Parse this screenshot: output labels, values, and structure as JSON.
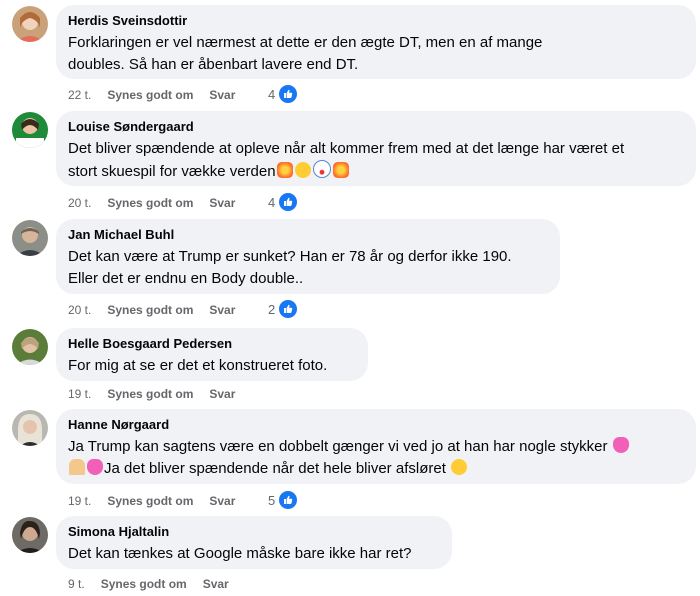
{
  "comments": [
    {
      "author": "Herdis Sveinsdottir",
      "text_lines": [
        "Forklaringen er vel nærmest at dette er den ægte DT, men en af mange",
        "doubles. Så han er åbenbart lavere end DT."
      ],
      "time": "22 t.",
      "like_label": "Synes godt om",
      "reply_label": "Svar",
      "reactions": "4"
    },
    {
      "author": "Louise Søndergaard",
      "text_lines": [
        "Det bliver spændende at opleve når alt kommer frem med at det længe har været et",
        "stort skuespil for vække verden"
      ],
      "time": "20 t.",
      "like_label": "Synes godt om",
      "reply_label": "Svar",
      "reactions": "4"
    },
    {
      "author": "Jan Michael Buhl",
      "text_lines": [
        "Det kan være at Trump er sunket? Han er 78 år og derfor ikke 190.",
        "Eller det er endnu en Body double.."
      ],
      "time": "20 t.",
      "like_label": "Synes godt om",
      "reply_label": "Svar",
      "reactions": "2"
    },
    {
      "author": "Helle Boesgaard Pedersen",
      "text_lines": [
        "For mig at se er det et konstrueret foto."
      ],
      "time": "19 t.",
      "like_label": "Synes godt om",
      "reply_label": "Svar",
      "reactions": ""
    },
    {
      "author": "Hanne Nørgaard",
      "text_lines": [
        "Ja Trump kan sagtens være en dobbelt gænger vi ved jo at han har nogle stykker",
        "Ja det bliver spændende når det hele bliver afsløret"
      ],
      "time": "19 t.",
      "like_label": "Synes godt om",
      "reply_label": "Svar",
      "reactions": "5"
    },
    {
      "author": "Simona Hjaltalin",
      "text_lines": [
        "Det kan tænkes at Google måske bare ikke har ret?"
      ],
      "time": "9 t.",
      "like_label": "Synes godt om",
      "reply_label": "Svar",
      "reactions": ""
    }
  ],
  "icons": {
    "reaction": "like-icon",
    "emoji": [
      "explosion-emoji",
      "dizzy-face-emoji",
      "clown-emoji",
      "pink-heart-emoji",
      "praying-hands-emoji",
      "winking-face-emoji"
    ]
  },
  "colors": {
    "bubble": "#f0f2f5",
    "meta": "#65676b",
    "like": "#1877f2"
  }
}
